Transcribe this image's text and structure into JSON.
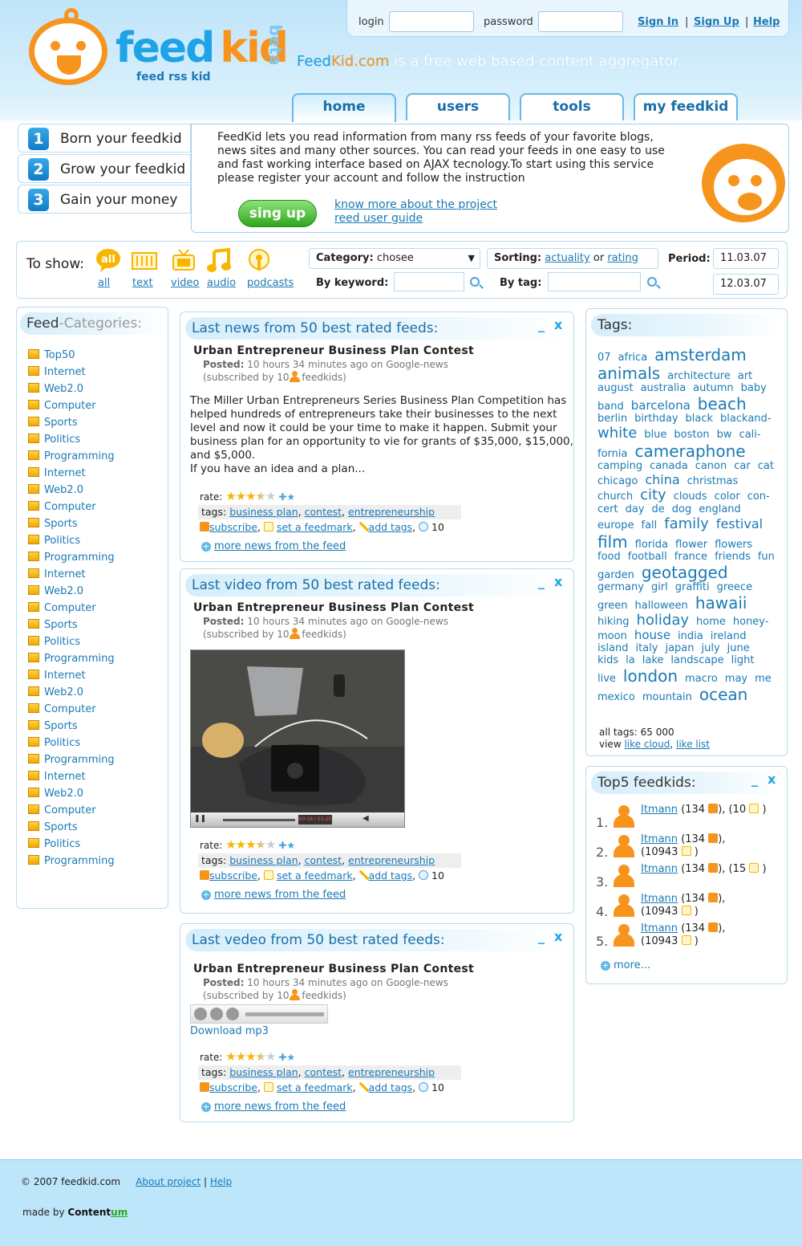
{
  "logo": {
    "feed": "feed",
    "kid": "kid",
    "sub": "feed rss kid",
    "beta": "beta"
  },
  "login": {
    "login_label": "login",
    "password_label": "password",
    "sign_in": "Sign In",
    "sign_up": "Sign Up",
    "help": "Help",
    "sep": "|"
  },
  "tagline": {
    "brand1": "Feed",
    "brand2": "Kid.com",
    "rest": " is a free web based content aggregator."
  },
  "tabs": [
    {
      "label": "home"
    },
    {
      "label": "users"
    },
    {
      "label": "tools"
    },
    {
      "label": "my feedkid"
    }
  ],
  "steps": [
    {
      "num": "1",
      "label": "Born your feedkid"
    },
    {
      "num": "2",
      "label": "Grow your feedkid"
    },
    {
      "num": "3",
      "label": "Gain your money"
    }
  ],
  "intro": {
    "text": "FeedKid lets you read information from many rss feeds of your favorite blogs, news sites and many other sources. You can read your feeds in one easy to use and fast working interface based on AJAX tecnology.To start using this service please register your account and follow the instruction",
    "button": "sing up",
    "link1": "know more about the project",
    "link2": "reed user guide"
  },
  "filter": {
    "to_show": "To show:",
    "types": [
      {
        "icon": "all-icon",
        "label": "all"
      },
      {
        "icon": "text-icon",
        "label": "text"
      },
      {
        "icon": "video-icon",
        "label": "video"
      },
      {
        "icon": "audio-icon",
        "label": "audio"
      },
      {
        "icon": "podcast-icon",
        "label": "podcasts"
      }
    ],
    "all_badge": "all",
    "category_label": "Category:",
    "category_value": "chosee",
    "sorting_label": "Sorting:",
    "sort_actuality": "actuality",
    "sort_or": "or",
    "sort_rating": "rating",
    "period_label": "Period:",
    "period_from": "11.03.07",
    "period_to": "12.03.07",
    "keyword_label": "By keyword:",
    "tag_label": "By tag:"
  },
  "categories": {
    "title_a": "Feed",
    "title_b": "-Categories:",
    "items": [
      "Top50",
      "Internet",
      "Web2.0",
      "Computer",
      "Sports",
      "Politics",
      "Programming",
      "Internet",
      "Web2.0",
      "Computer",
      "Sports",
      "Politics",
      "Programming",
      "Internet",
      "Web2.0",
      "Computer",
      "Sports",
      "Politics",
      "Programming",
      "Internet",
      "Web2.0",
      "Computer",
      "Sports",
      "Politics",
      "Programming",
      "Internet",
      "Web2.0",
      "Computer",
      "Sports",
      "Politics",
      "Programming"
    ]
  },
  "news": [
    {
      "header": "Last news from 50 best rated feeds:",
      "title": "Urban Entrepreneur Business Plan Contest",
      "posted_label": "Posted:",
      "posted": "10 hours 34 minutes ago on Google-news",
      "subscribed_a": "(subscribed by 10",
      "subscribed_b": "feedkids)",
      "body1": "The Miller Urban Entrepreneurs Series Business Plan Competition has helped hundreds of entrepreneurs take their businesses to the next level and now it could be your time to make it happen. Submit your business plan for an opportunity to vie for grants of $35,000, $15,000, and $5,000.",
      "body2": "If you have an idea and a plan...",
      "rate_label": "rate:",
      "rating": 3.5,
      "tags_label": "tags:",
      "tags": [
        "business plan",
        "contest",
        "entrepreneurship"
      ],
      "subscribe": "subscribe",
      "feedmark": "set a feedmark",
      "addtags": "add tags",
      "comments": "10",
      "more": "more news from the feed"
    },
    {
      "header": "Last video from 50 best rated feeds:",
      "title": "Urban Entrepreneur Business Plan Contest",
      "posted_label": "Posted:",
      "posted": "10 hours 34 minutes ago on Google-news",
      "subscribed_a": "(subscribed by 10",
      "subscribed_b": "feedkids)",
      "video_time": "00:18 / 03:25",
      "rate_label": "rate:",
      "rating": 3.5,
      "tags_label": "tags:",
      "tags": [
        "business plan",
        "contest",
        "entrepreneurship"
      ],
      "subscribe": "subscribe",
      "feedmark": "set a feedmark",
      "addtags": "add tags",
      "comments": "10",
      "more": "more news from the feed"
    },
    {
      "header": "Last vedeo from 50 best rated feeds:",
      "title": "Urban Entrepreneur Business Plan Contest",
      "posted_label": "Posted:",
      "posted": "10 hours 34 minutes ago on Google-news",
      "subscribed_a": "(subscribed by 10",
      "subscribed_b": "feedkids)",
      "download": "Download mp3",
      "rate_label": "rate:",
      "rating": 3.5,
      "tags_label": "tags:",
      "tags": [
        "business plan",
        "contest",
        "entrepreneurship"
      ],
      "subscribe": "subscribe",
      "feedmark": "set a feedmark",
      "addtags": "add tags",
      "comments": "10",
      "more": "more news from the feed"
    }
  ],
  "tags": {
    "title": "Tags:",
    "cloud": [
      {
        "t": "07",
        "s": 13
      },
      {
        "t": "africa",
        "s": 13
      },
      {
        "t": "amsterdam",
        "s": 20
      },
      {
        "t": "animals",
        "s": 20
      },
      {
        "t": "architecture",
        "s": 13
      },
      {
        "t": "art",
        "s": 13
      },
      {
        "t": "august",
        "s": 13
      },
      {
        "t": "australia",
        "s": 13
      },
      {
        "t": "autumn",
        "s": 13
      },
      {
        "t": "baby",
        "s": 13
      },
      {
        "t": "band",
        "s": 13
      },
      {
        "t": "barcelona",
        "s": 15
      },
      {
        "t": "beach",
        "s": 20
      },
      {
        "t": "berlin",
        "s": 13
      },
      {
        "t": "birthday",
        "s": 13
      },
      {
        "t": "black",
        "s": 13
      },
      {
        "t": "blackand-",
        "s": 13
      },
      {
        "t": "white",
        "s": 18
      },
      {
        "t": "blue",
        "s": 13
      },
      {
        "t": "boston",
        "s": 13
      },
      {
        "t": "bw",
        "s": 13
      },
      {
        "t": "cali-",
        "s": 13
      },
      {
        "t": "fornia",
        "s": 13
      },
      {
        "t": "cameraphone",
        "s": 20
      },
      {
        "t": "camping",
        "s": 13
      },
      {
        "t": "canada",
        "s": 13
      },
      {
        "t": "canon",
        "s": 13
      },
      {
        "t": "car",
        "s": 13
      },
      {
        "t": "cat",
        "s": 13
      },
      {
        "t": "chicago",
        "s": 13
      },
      {
        "t": "china",
        "s": 16
      },
      {
        "t": "christmas",
        "s": 13
      },
      {
        "t": "church",
        "s": 13
      },
      {
        "t": "city",
        "s": 18
      },
      {
        "t": "clouds",
        "s": 13
      },
      {
        "t": "color",
        "s": 13
      },
      {
        "t": "con-",
        "s": 13
      },
      {
        "t": "cert",
        "s": 13
      },
      {
        "t": "day",
        "s": 13
      },
      {
        "t": "de",
        "s": 13
      },
      {
        "t": "dog",
        "s": 13
      },
      {
        "t": "england",
        "s": 13
      },
      {
        "t": "europe",
        "s": 13
      },
      {
        "t": "fall",
        "s": 13
      },
      {
        "t": "family",
        "s": 18
      },
      {
        "t": "festival",
        "s": 16
      },
      {
        "t": "film",
        "s": 20
      },
      {
        "t": "florida",
        "s": 13
      },
      {
        "t": "flower",
        "s": 13
      },
      {
        "t": "flowers",
        "s": 13
      },
      {
        "t": "food",
        "s": 13
      },
      {
        "t": "football",
        "s": 13
      },
      {
        "t": "france",
        "s": 13
      },
      {
        "t": "friends",
        "s": 13
      },
      {
        "t": "fun",
        "s": 13
      },
      {
        "t": "garden",
        "s": 13
      },
      {
        "t": "geotagged",
        "s": 20
      },
      {
        "t": "germany",
        "s": 13
      },
      {
        "t": "girl",
        "s": 13
      },
      {
        "t": "graffiti",
        "s": 13
      },
      {
        "t": "greece",
        "s": 13
      },
      {
        "t": "green",
        "s": 13
      },
      {
        "t": "halloween",
        "s": 13
      },
      {
        "t": "hawaii",
        "s": 20
      },
      {
        "t": "hiking",
        "s": 13
      },
      {
        "t": "holiday",
        "s": 18
      },
      {
        "t": "home",
        "s": 13
      },
      {
        "t": "honey-",
        "s": 13
      },
      {
        "t": "moon",
        "s": 13
      },
      {
        "t": "house",
        "s": 15
      },
      {
        "t": "india",
        "s": 13
      },
      {
        "t": "ireland",
        "s": 13
      },
      {
        "t": "island",
        "s": 13
      },
      {
        "t": "italy",
        "s": 13
      },
      {
        "t": "japan",
        "s": 13
      },
      {
        "t": "july",
        "s": 13
      },
      {
        "t": "june",
        "s": 13
      },
      {
        "t": "kids",
        "s": 13
      },
      {
        "t": "la",
        "s": 13
      },
      {
        "t": "lake",
        "s": 13
      },
      {
        "t": "landscape",
        "s": 13
      },
      {
        "t": "light",
        "s": 13
      },
      {
        "t": "live",
        "s": 13
      },
      {
        "t": "london",
        "s": 20
      },
      {
        "t": "macro",
        "s": 13
      },
      {
        "t": "may",
        "s": 13
      },
      {
        "t": "me",
        "s": 13
      },
      {
        "t": "mexico",
        "s": 13
      },
      {
        "t": "mountain",
        "s": 13
      },
      {
        "t": "ocean",
        "s": 20
      }
    ],
    "all_tags": "all tags: 65 000",
    "view": "view",
    "like_cloud": "like cloud",
    "like_list": "like list"
  },
  "top5": {
    "title": "Top5 feedkids:",
    "rows": [
      {
        "n": "1.",
        "name": "Itmann",
        "a": "(134",
        "b": "), (10",
        "c": ")"
      },
      {
        "n": "2.",
        "name": "Itmann",
        "a": "(134",
        "b": "),",
        "b2": "(10943",
        "c": ")"
      },
      {
        "n": "3.",
        "name": "Itmann",
        "a": "(134",
        "b": "), (15",
        "c": ")"
      },
      {
        "n": "4.",
        "name": "Itmann",
        "a": "(134",
        "b": "),",
        "b2": "(10943",
        "c": ")"
      },
      {
        "n": "5.",
        "name": "Itmann",
        "a": "(134",
        "b": "),",
        "b2": "(10943",
        "c": ")"
      }
    ],
    "more": "more..."
  },
  "footer": {
    "copyright": "© 2007 feedkid.com",
    "about": "About project",
    "help": "Help",
    "made_by": "made by",
    "content_a": "Content",
    "content_b": "um"
  },
  "colors": {
    "accent": "#1ea3e6",
    "orange": "#f7941d",
    "link": "#1a7ab5"
  }
}
